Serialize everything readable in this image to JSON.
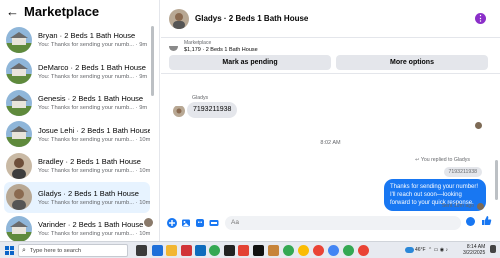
{
  "marketplace": {
    "title": "Marketplace",
    "conversations": [
      {
        "title": "Bryan · 2 Beds 1 Bath House",
        "preview": "You: Thanks for sending your numb...",
        "time": "9m"
      },
      {
        "title": "DeMarco · 2 Beds 1 Bath House",
        "preview": "You: Thanks for sending your numb...",
        "time": "9m"
      },
      {
        "title": "Genesis · 2 Beds 1 Bath House",
        "preview": "You: Thanks for sending your numb...",
        "time": "9m"
      },
      {
        "title": "Josue Lehi · 2 Beds 1 Bath House",
        "preview": "You: Thanks for sending your numb...",
        "time": "10m"
      },
      {
        "title": "Bradley · 2 Beds 1 Bath House",
        "preview": "You: Thanks for sending your numb...",
        "time": "10m"
      },
      {
        "title": "Gladys · 2 Beds 1 Bath House",
        "preview": "You: Thanks for sending your numb...",
        "time": "10m"
      },
      {
        "title": "Varinder · 2 Beds 1 Bath House",
        "preview": "You: Thanks for sending your numb...",
        "time": "10m"
      }
    ]
  },
  "conversation": {
    "title": "Gladys · 2 Beds 1 Bath House",
    "menu_icon": "more-options-icon",
    "listing_label": "Marketplace",
    "listing_price": "$1,179 · 2 Beds 1 Bath House",
    "mark_pending_label": "Mark as pending",
    "more_options_label": "More options",
    "sender_name": "Gladys",
    "incoming_message": "7193211938",
    "timestamp": "8:02 AM",
    "replied_label": "You replied to Gladys",
    "reply_quote": "7193211938",
    "outgoing_message": "Thanks for sending your number! I'll reach out soon—looking forward to your quick response.",
    "sent_label": "Sent 10m ago",
    "input_placeholder": "Aa"
  },
  "taskbar": {
    "search_placeholder": "Type here to search",
    "weather": "46°F",
    "time": "8:14 AM",
    "date": "3/22/2025"
  },
  "colors": {
    "accent": "#1877f2",
    "selected_bg": "#e7f3ff",
    "button_bg": "#e4e6eb",
    "kebab": "#8b2fc9"
  }
}
